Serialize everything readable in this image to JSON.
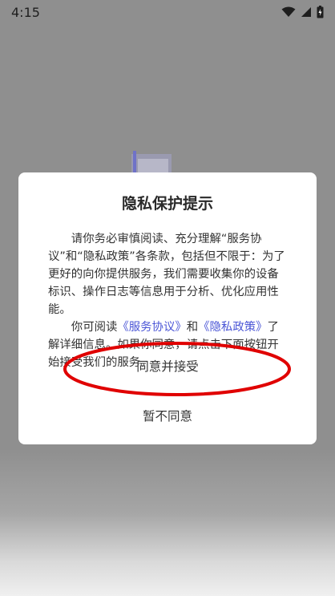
{
  "status_bar": {
    "time": "4:15",
    "icons": [
      "wifi-icon",
      "signal-icon",
      "battery-icon"
    ]
  },
  "dialog": {
    "title": "隐私保护提示",
    "paragraph1": "请你务必审慎阅读、充分理解“服务协议”和“隐私政策”各条款，包括但不限于：为了更好的向你提供服务，我们需要收集你的设备标识、操作日志等信息用于分析、优化应用性能。",
    "paragraph2_prefix": "你可阅读",
    "service_agreement_link": "《服务协议》",
    "conjunction": "和",
    "privacy_policy_link": "《隐私政策》",
    "paragraph2_suffix": "了解详细信息。如果你同意，请点击下面按钮开始接受我们的服务。",
    "agree_button": "同意并接受",
    "disagree_button": "暂不同意"
  },
  "colors": {
    "link": "#4a55d6",
    "annotation": "#e00000",
    "overlay": "#8f8f8f"
  }
}
